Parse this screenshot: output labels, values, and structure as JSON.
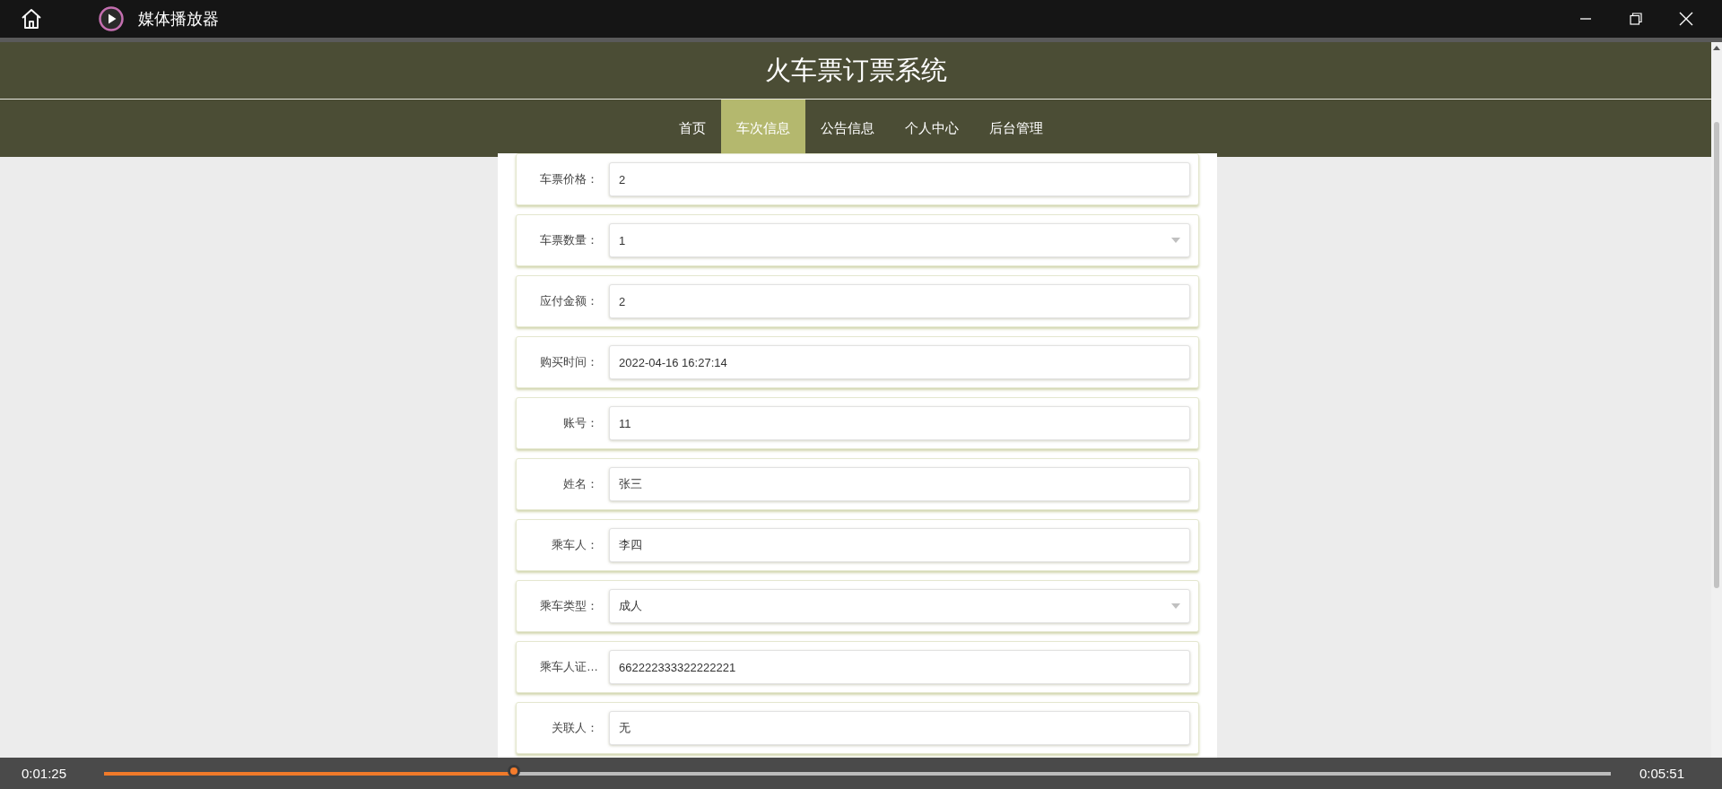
{
  "window": {
    "app_title": "媒体播放器"
  },
  "site": {
    "title": "火车票订票系统",
    "nav": [
      {
        "label": "首页",
        "selected": false
      },
      {
        "label": "车次信息",
        "selected": true
      },
      {
        "label": "公告信息",
        "selected": false
      },
      {
        "label": "个人中心",
        "selected": false
      },
      {
        "label": "后台管理",
        "selected": false
      }
    ]
  },
  "form": {
    "fields": [
      {
        "label": "车票价格：",
        "value": "2",
        "kind": "text"
      },
      {
        "label": "车票数量：",
        "value": "1",
        "kind": "select"
      },
      {
        "label": "应付金额：",
        "value": "2",
        "kind": "text"
      },
      {
        "label": "购买时间：",
        "value": "2022-04-16 16:27:14",
        "kind": "text"
      },
      {
        "label": "账号：",
        "value": "11",
        "kind": "text"
      },
      {
        "label": "姓名：",
        "value": "张三",
        "kind": "text"
      },
      {
        "label": "乘车人：",
        "value": "李四",
        "kind": "text"
      },
      {
        "label": "乘车类型：",
        "value": "成人",
        "kind": "select"
      },
      {
        "label": "乘车人证…",
        "value": "662222333322222221",
        "kind": "text"
      },
      {
        "label": "关联人：",
        "value": "无",
        "kind": "text"
      }
    ]
  },
  "player": {
    "elapsed": "0:01:25",
    "total": "0:05:51",
    "level": 0.274
  }
}
